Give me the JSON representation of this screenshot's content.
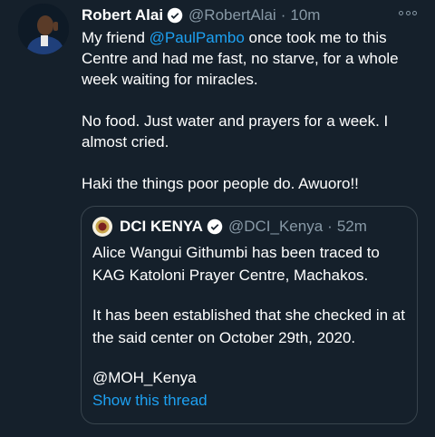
{
  "tweet": {
    "author_name": "Robert Alai",
    "author_handle": "@RobertAlai",
    "time": "10m",
    "separator": "·",
    "text_line1_prefix": "My friend ",
    "text_line1_mention": "@PaulPambo",
    "text_line1_suffix": " once took me to this Centre and had me fast, no starve, for a whole week waiting for miracles.",
    "text_para2": "No food. Just water and prayers for a week. I almost cried.",
    "text_para3": "Haki the things poor people do. Awuoro!!"
  },
  "quoted_tweet": {
    "author_name": "DCI KENYA",
    "author_handle": "@DCI_Kenya",
    "time": "52m",
    "separator": "·",
    "para1": "Alice Wangui Githumbi has been traced to KAG Katoloni Prayer Centre, Machakos.",
    "para2": " It has been established that she checked in at the said center on October 29th, 2020.",
    "para3": "@MOH_Kenya",
    "show_thread": "Show this thread"
  },
  "icons": {
    "verified": "verified-badge-icon",
    "more": "more-options-icon"
  },
  "colors": {
    "background": "#15202b",
    "link": "#1da1f2",
    "secondary_text": "#8899a6",
    "border": "#38444d"
  }
}
